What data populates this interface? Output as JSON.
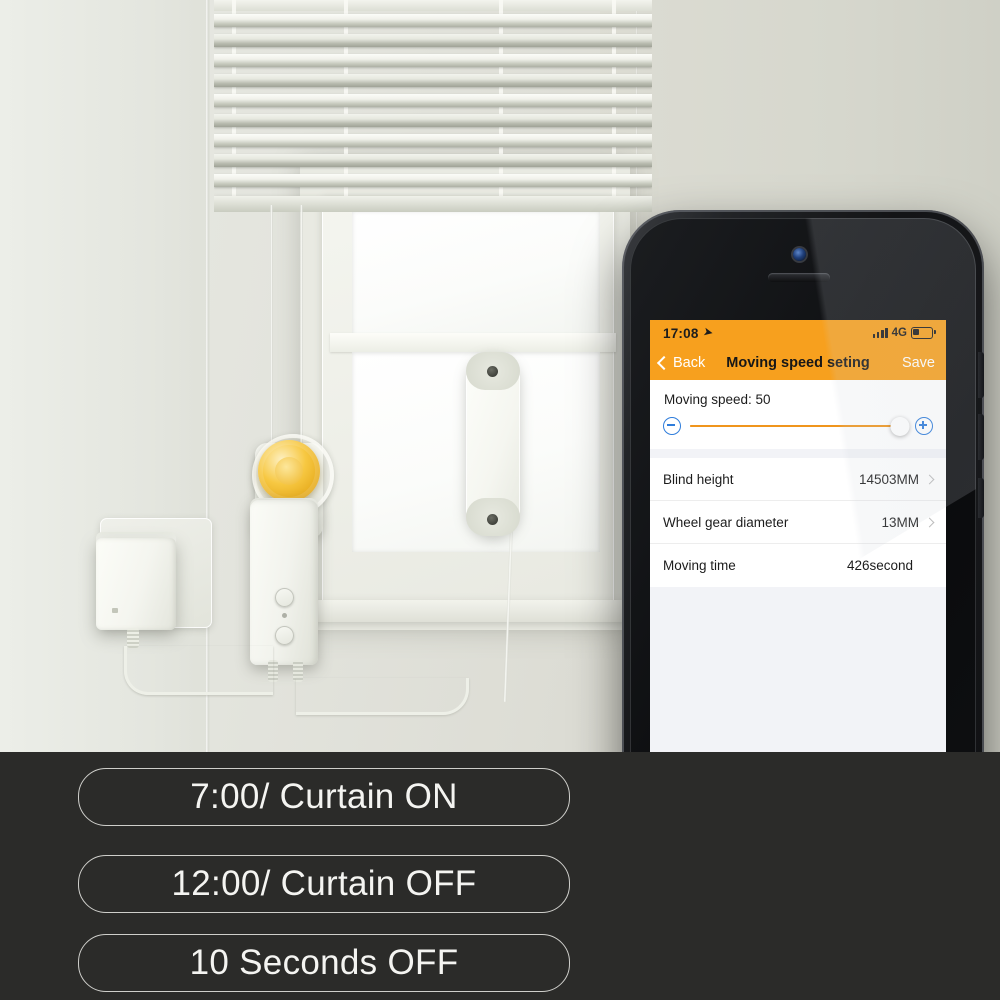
{
  "scene": {
    "description": "Smart curtain motor installed beside a window with venetian blinds, power adapter in wall socket, and a phone showing the app",
    "objects": {
      "blinds": "venetian-blinds",
      "motor": "curtain-motor-drive",
      "gear": "yellow-drive-gear",
      "adapter": "power-adapter",
      "socket": "wall-socket",
      "sensor": "window-mounted-sensor"
    }
  },
  "phone": {
    "status_bar": {
      "time": "17:08",
      "location_icon": "location-arrow-icon",
      "signal_icon": "signal-bars-icon",
      "network": "4G",
      "battery_icon": "battery-icon"
    },
    "nav": {
      "back_label": "Back",
      "title": "Moving speed seting",
      "save_label": "Save"
    },
    "speed": {
      "label": "Moving speed: 50",
      "value": 50,
      "min": 0,
      "max": 100,
      "decrease_icon": "minus-circle-icon",
      "increase_icon": "plus-circle-icon"
    },
    "rows": [
      {
        "label": "Blind height",
        "value": "14503MM",
        "chevron": true
      },
      {
        "label": "Wheel gear diameter",
        "value": "13MM",
        "chevron": true
      },
      {
        "label": "Moving time",
        "value": "426second",
        "chevron": false
      }
    ],
    "home_button": "home-button"
  },
  "banner": {
    "items": [
      "7:00/ Curtain ON",
      "12:00/ Curtain OFF",
      "10 Seconds OFF"
    ]
  },
  "colors": {
    "accent_orange": "#f7a01e",
    "slider_orange": "#f0951c",
    "control_blue": "#2f7ddb",
    "band_dark": "#2b2b29",
    "screen_bg": "#f2f3f7"
  }
}
